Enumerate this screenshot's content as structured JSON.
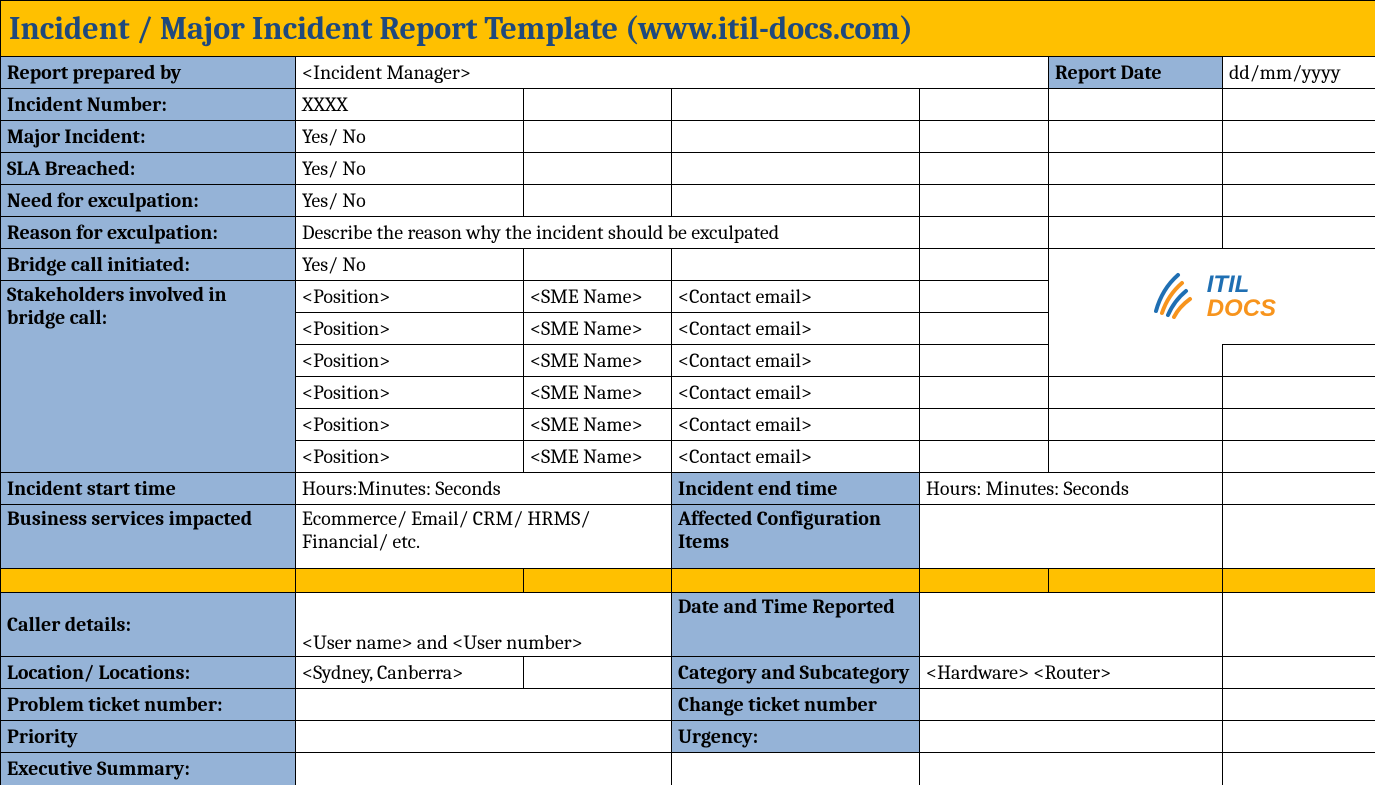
{
  "title": "Incident / Major Incident Report Template   (www.itil-docs.com)",
  "rows": {
    "report_prepared_by": {
      "label": "Report prepared by",
      "value": "<Incident Manager>"
    },
    "report_date": {
      "label": "Report Date",
      "value": "dd/mm/yyyy"
    },
    "incident_number": {
      "label": "Incident Number:",
      "value": "XXXX"
    },
    "major_incident": {
      "label": "Major Incident:",
      "value": "Yes/ No"
    },
    "sla_breached": {
      "label": "SLA Breached:",
      "value": "Yes/ No"
    },
    "need_exculpation": {
      "label": "Need for exculpation:",
      "value": "Yes/ No"
    },
    "reason_exculpation": {
      "label": "Reason for exculpation:",
      "value": "Describe the reason why the incident should be exculpated"
    },
    "bridge_call": {
      "label": "Bridge call initiated:",
      "value": "Yes/ No"
    },
    "stakeholders_label": "Stakeholders involved in bridge call:",
    "stakeholders": [
      {
        "position": "<Position>",
        "sme": "<SME Name>",
        "email": "<Contact email>"
      },
      {
        "position": "<Position>",
        "sme": "<SME Name>",
        "email": "<Contact email>"
      },
      {
        "position": "<Position>",
        "sme": "<SME Name>",
        "email": "<Contact email>"
      },
      {
        "position": "<Position>",
        "sme": "<SME Name>",
        "email": "<Contact email>"
      },
      {
        "position": "<Position>",
        "sme": "<SME Name>",
        "email": "<Contact email>"
      },
      {
        "position": "<Position>",
        "sme": "<SME Name>",
        "email": "<Contact email>"
      }
    ],
    "incident_start": {
      "label": "Incident start time",
      "value": "Hours:Minutes: Seconds"
    },
    "incident_end": {
      "label": "Incident end time",
      "value": "Hours: Minutes: Seconds"
    },
    "business_services": {
      "label": "Business services impacted",
      "value": "Ecommerce/ Email/ CRM/ HRMS/ Financial/ etc."
    },
    "affected_ci": {
      "label": "Affected Configuration Items",
      "value": ""
    },
    "caller_details": {
      "label": "Caller details:",
      "value": "<User name> and <User number>"
    },
    "date_time_reported": {
      "label": "Date and Time Reported",
      "value": ""
    },
    "location": {
      "label": "Location/ Locations:",
      "value": "<Sydney, Canberra>"
    },
    "category": {
      "label": "Category and Subcategory",
      "value": "<Hardware> <Router>"
    },
    "problem_ticket": {
      "label": "Problem ticket number:",
      "value": ""
    },
    "change_ticket": {
      "label": "Change ticket number",
      "value": ""
    },
    "priority": {
      "label": "Priority",
      "value": ""
    },
    "urgency": {
      "label": "Urgency:",
      "value": ""
    },
    "executive_summary": {
      "label": "Executive Summary:"
    }
  },
  "logo": {
    "line1": "ITIL",
    "line2": "DOCS"
  }
}
